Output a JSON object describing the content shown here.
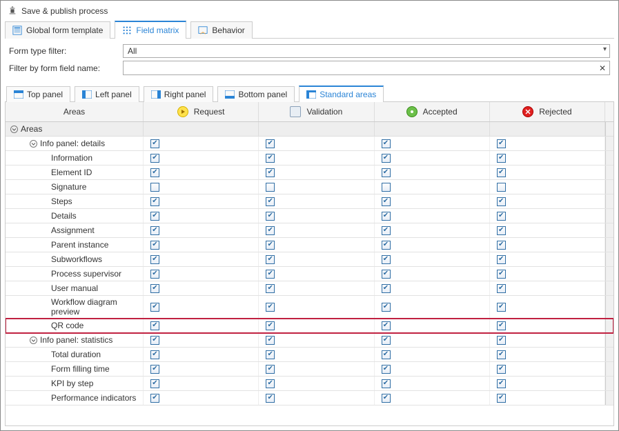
{
  "titlebar": {
    "title": "Save & publish process"
  },
  "main_tabs": [
    {
      "label": "Global form template"
    },
    {
      "label": "Field matrix",
      "active": true
    },
    {
      "label": "Behavior"
    }
  ],
  "filters": {
    "type_label": "Form type filter:",
    "type_value": "All",
    "field_label": "Filter by form field name:",
    "field_value": ""
  },
  "panel_tabs": [
    {
      "label": "Top panel"
    },
    {
      "label": "Left panel"
    },
    {
      "label": "Right panel"
    },
    {
      "label": "Bottom panel"
    },
    {
      "label": "Standard areas",
      "active": true
    }
  ],
  "columns": {
    "areas": "Areas",
    "request": "Request",
    "validation": "Validation",
    "accepted": "Accepted",
    "rejected": "Rejected"
  },
  "top_group": {
    "label": "Areas"
  },
  "groups": [
    {
      "label": "Info panel: details",
      "header_checks": [
        true,
        true,
        true,
        true
      ],
      "rows": [
        {
          "label": "Information",
          "c": [
            true,
            true,
            true,
            true
          ]
        },
        {
          "label": "Element ID",
          "c": [
            true,
            true,
            true,
            true
          ]
        },
        {
          "label": "Signature",
          "c": [
            false,
            false,
            false,
            false
          ]
        },
        {
          "label": "Steps",
          "c": [
            true,
            true,
            true,
            true
          ]
        },
        {
          "label": "Details",
          "c": [
            true,
            true,
            true,
            true
          ]
        },
        {
          "label": "Assignment",
          "c": [
            true,
            true,
            true,
            true
          ]
        },
        {
          "label": "Parent instance",
          "c": [
            true,
            true,
            true,
            true
          ]
        },
        {
          "label": "Subworkflows",
          "c": [
            true,
            true,
            true,
            true
          ]
        },
        {
          "label": "Process supervisor",
          "c": [
            true,
            true,
            true,
            true
          ]
        },
        {
          "label": "User manual",
          "c": [
            true,
            true,
            true,
            true
          ]
        },
        {
          "label": "Workflow diagram preview",
          "c": [
            true,
            true,
            true,
            true
          ]
        },
        {
          "label": "QR code",
          "c": [
            true,
            true,
            true,
            true
          ],
          "highlight": true
        }
      ]
    },
    {
      "label": "Info panel: statistics",
      "header_checks": [
        true,
        true,
        true,
        true
      ],
      "rows": [
        {
          "label": "Total duration",
          "c": [
            true,
            true,
            true,
            true
          ]
        },
        {
          "label": "Form filling time",
          "c": [
            true,
            true,
            true,
            true
          ]
        },
        {
          "label": "KPI by step",
          "c": [
            true,
            true,
            true,
            true
          ]
        },
        {
          "label": "Performance indicators",
          "c": [
            true,
            true,
            true,
            true
          ]
        }
      ]
    }
  ]
}
